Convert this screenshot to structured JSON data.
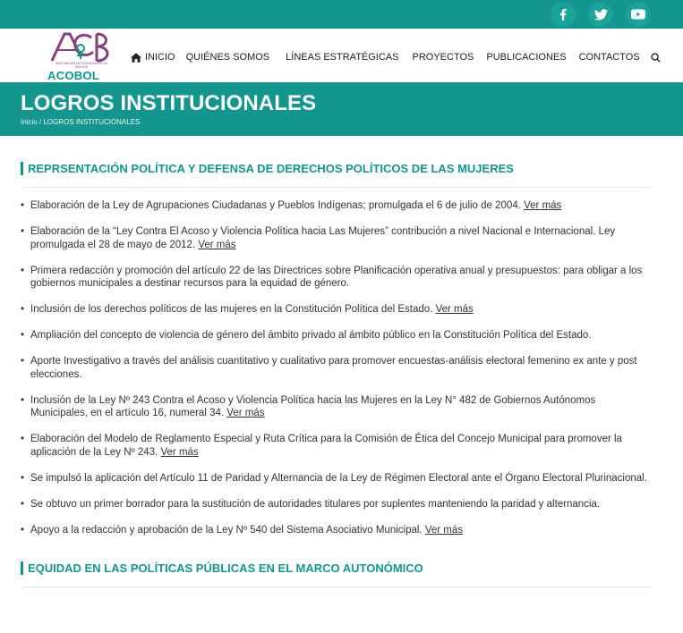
{
  "social": [
    {
      "icon": "facebook-icon"
    },
    {
      "icon": "twitter-icon"
    },
    {
      "icon": "youtube-icon"
    }
  ],
  "logo": {
    "text": "ACOBOL",
    "subtitle": "ASOCIACIÓN DE CONCEJALAS DE BOLIVIA"
  },
  "nav": {
    "home": "INICIO",
    "about": "QUIÉNES SOMOS",
    "lines": "LÍNEAS ESTRATÉGICAS",
    "projects": "PROYECTOS",
    "publications": "PUBLICACIONES",
    "contacts": "CONTACTOS"
  },
  "hero": {
    "title": "LOGROS INSTITUCIONALES",
    "crumb_home": "Inicio",
    "crumb_sep": " / ",
    "crumb_current": "LOGROS INSTITUCIONALES"
  },
  "section1": {
    "title": "REPRSENTACIÓN POLÍTICA Y DEFENSA DE DERECHOS POLÍTICOS DE LAS MUJERES",
    "more_label": "Ver más",
    "items": [
      {
        "text": "Elaboración de la Ley de Agrupaciones Ciudadanas y Pueblos Indígenas; promulgada el 6 de julio de 2004. ",
        "more": "Ver más"
      },
      {
        "text": "Elaboración de la “Ley Contra El Acoso y Violencia Política hacia Las Mujeres” contribución a nivel Nacional e Internacional. Ley promulgada el 28 de mayo de 2012. ",
        "more": "Ver más"
      },
      {
        "text": "Primera redacción y promoción del artículo 22 de las Directrices sobre Planificación operativa anual y presupuestos: para obligar a los gobiernos municipales a destinar recursos para la equidad de género.",
        "more": ""
      },
      {
        "text": "Inclusión de los derechos políticos de las mujeres en la Constitución Política del Estado. ",
        "more": "Ver más"
      },
      {
        "text": "Ampliación del concepto de violencia de género del ámbito privado al ámbito público en la Constitución Política del Estado.",
        "more": ""
      },
      {
        "text": "Aporte Investigativo a través del análisis cuantitativo y cualitativo para promover encuestas-análisis electoral femenino ex ante y post elecciones.",
        "more": ""
      },
      {
        "text": "Inclusión de la Ley Nº 243 Contra el Acoso y Violencia Política hacia las Mujeres en la Ley N° 482 de Gobiernos Autónomos Municipales, en el artículo 16, numeral 34. ",
        "more": "Ver más"
      },
      {
        "text": "Elaboración del Modelo de Reglamento Especial y Ruta Crítica para la Comisión de Ética del Concejo Municipal para promover la aplicación de la Ley Nº 243. ",
        "more": "Ver más"
      },
      {
        "text": "Se impulsó la aplicación del Artículo 11 de Paridad y Alternancia de la Ley de Régimen Electoral ante el Órgano Electoral Plurinacional.",
        "more": ""
      },
      {
        "text": "Se obtuvo un primer borrador para la sustitución de autoridades titulares por suplentes manteniendo la paridad y alternancia.",
        "more": ""
      },
      {
        "text": "Apoyo a la redacción y aprobación de la Ley Nº 540 del Sistema Asociativo Municipal. ",
        "more": "Ver más"
      }
    ]
  },
  "section2": {
    "title": "EQUIDAD EN LAS POLÍTICAS PÚBLICAS EN EL MARCO AUTONÓMICO"
  },
  "colors": {
    "accent": "#14958e",
    "logo_purple": "#8a3f79"
  }
}
